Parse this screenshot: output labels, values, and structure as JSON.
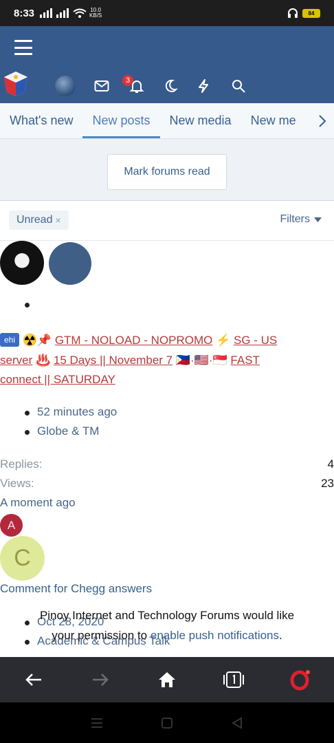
{
  "status": {
    "time": "8:33",
    "netspeed_top": "10.0",
    "netspeed_bottom": "KB/S",
    "battery": "84"
  },
  "header": {
    "notification_count": "3"
  },
  "tabs": [
    {
      "label": "What's new"
    },
    {
      "label": "New posts"
    },
    {
      "label": "New media"
    },
    {
      "label": "New me"
    }
  ],
  "actions": {
    "mark_read": "Mark forums read"
  },
  "filters": {
    "chip": "Unread",
    "chip_close": "×",
    "filters_label": "Filters"
  },
  "thread1": {
    "prefix": "ehi",
    "title_line1": "GTM - NOLOAD - NOPROMO",
    "title_line1b": "SG - US",
    "title_line2a": "server",
    "title_line2b": "15 Days || November 7",
    "title_line2c": "FAST",
    "title_line3": "connect || SATURDAY",
    "time": "52 minutes ago",
    "forum": "Globe & TM"
  },
  "stats": {
    "replies_label": "Replies:",
    "replies": "4",
    "views_label": "Views:",
    "views": "23",
    "last_post": "A moment ago"
  },
  "avatars": {
    "a": "A",
    "c": "C"
  },
  "thread2": {
    "title": "Comment for Chegg answers",
    "date": "Oct 28, 2020",
    "forum": "Academic & Campus Talk"
  },
  "push": {
    "line1": "Pinoy Internet and Technology Forums would like",
    "line2a": "your permission to",
    "link": "enable push notifications",
    "line2b": "."
  }
}
